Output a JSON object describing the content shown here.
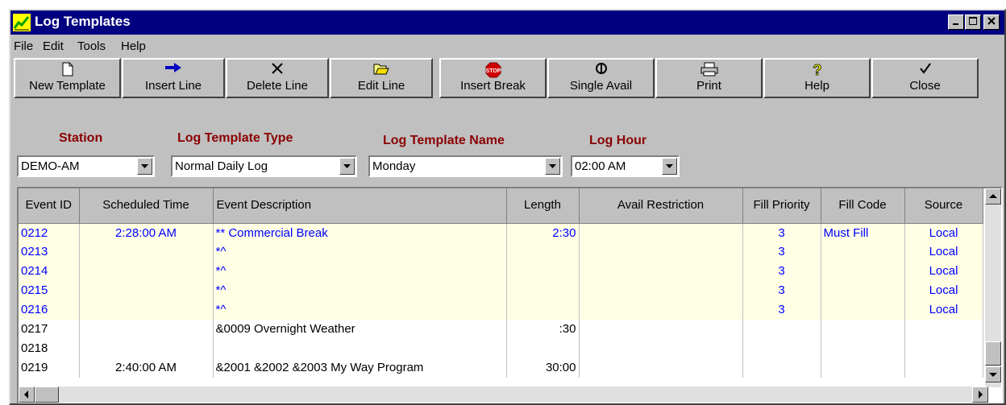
{
  "window": {
    "title": "Log Templates"
  },
  "menu": [
    "File",
    "Edit",
    "Tools",
    "Help"
  ],
  "toolbar": [
    {
      "label": "New Template",
      "icon": "new-document-icon"
    },
    {
      "label": "Insert Line",
      "icon": "arrow-right-icon"
    },
    {
      "label": "Delete Line",
      "icon": "delete-x-icon"
    },
    {
      "label": "Edit Line",
      "icon": "open-folder-icon"
    },
    {
      "label": "Insert Break",
      "icon": "stop-sign-icon"
    },
    {
      "label": "Single Avail",
      "icon": "single-avail-icon"
    },
    {
      "label": "Print",
      "icon": "printer-icon"
    },
    {
      "label": "Help",
      "icon": "help-question-icon"
    },
    {
      "label": "Close",
      "icon": "checkmark-icon"
    }
  ],
  "filters": {
    "station": {
      "label": "Station",
      "value": "DEMO-AM"
    },
    "type": {
      "label": "Log Template Type",
      "value": "Normal Daily Log"
    },
    "name": {
      "label": "Log Template Name",
      "value": "Monday"
    },
    "hour": {
      "label": "Log Hour",
      "value": "02:00 AM"
    }
  },
  "grid": {
    "columns": [
      "Event ID",
      "Scheduled Time",
      "Event Description",
      "Length",
      "Avail Restriction",
      "Fill Priority",
      "Fill Code",
      "Source"
    ],
    "rows": [
      {
        "id": "0212",
        "time": "2:28:00 AM",
        "desc": "** Commercial Break",
        "length": "2:30",
        "avail": "",
        "priority": "3",
        "fill": "Must Fill",
        "source": "Local",
        "highlight": true
      },
      {
        "id": "0213",
        "time": "",
        "desc": "*^",
        "length": "",
        "avail": "",
        "priority": "3",
        "fill": "",
        "source": "Local",
        "highlight": true
      },
      {
        "id": "0214",
        "time": "",
        "desc": "*^",
        "length": "",
        "avail": "",
        "priority": "3",
        "fill": "",
        "source": "Local",
        "highlight": true
      },
      {
        "id": "0215",
        "time": "",
        "desc": "*^",
        "length": "",
        "avail": "",
        "priority": "3",
        "fill": "",
        "source": "Local",
        "highlight": true
      },
      {
        "id": "0216",
        "time": "",
        "desc": "*^",
        "length": "",
        "avail": "",
        "priority": "3",
        "fill": "",
        "source": "Local",
        "highlight": true
      },
      {
        "id": "0217",
        "time": "",
        "desc": "&0009  Overnight Weather",
        "length": ":30",
        "avail": "",
        "priority": "",
        "fill": "",
        "source": "",
        "highlight": false
      },
      {
        "id": "0218",
        "time": "",
        "desc": "",
        "length": "",
        "avail": "",
        "priority": "",
        "fill": "",
        "source": "",
        "highlight": false
      },
      {
        "id": "0219",
        "time": "2:40:00 AM",
        "desc": "&2001  &2002  &2003  My Way Program",
        "length": "30:00",
        "avail": "",
        "priority": "",
        "fill": "",
        "source": "",
        "highlight": false
      }
    ]
  }
}
